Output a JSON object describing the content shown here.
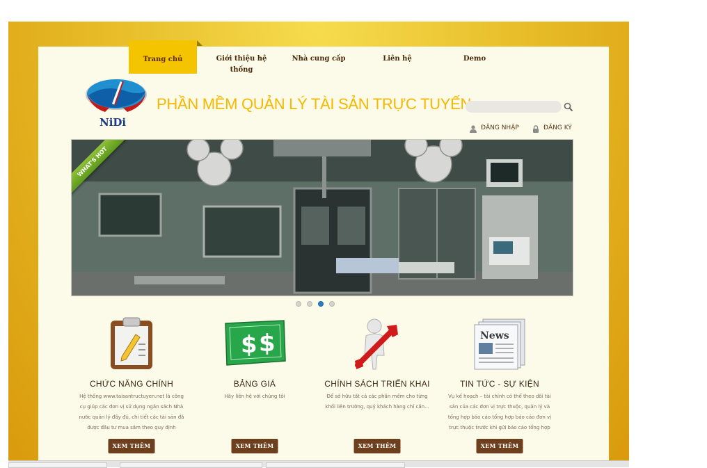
{
  "nav": {
    "items": [
      {
        "label": "Trang chủ",
        "active": true
      },
      {
        "label": "Giới thiệu hệ thống",
        "active": false
      },
      {
        "label": "Nhà cung cấp",
        "active": false
      },
      {
        "label": "Liên hệ",
        "active": false
      },
      {
        "label": "Demo",
        "active": false
      }
    ]
  },
  "header": {
    "logo_text": "NiDi",
    "site_title": "PHẦN MỀM QUẢN LÝ TÀI SẢN TRỰC TUYẾN",
    "search_placeholder": "",
    "search_icon": "magnifier-icon",
    "login_label": "ĐĂNG NHẬP",
    "register_label": "ĐĂNG KÝ"
  },
  "slider": {
    "ribbon_text": "WHAT'S HOT",
    "slide_count": 4,
    "active_slide": 3
  },
  "features": [
    {
      "icon": "clipboard-icon",
      "title": "CHỨC NĂNG CHÍNH",
      "description": "Hệ thống www.taisantructuyen.net là công cụ giúp các đơn vị sử dụng ngân sách Nhà nước quản lý đầy đủ, chi tiết các tài sản đã được đầu tư mua sắm theo quy định",
      "button": "XEM THÊM"
    },
    {
      "icon": "money-icon",
      "title": "BẢNG GIÁ",
      "description": "Hãy liên hệ với chúng tôi",
      "button": "XEM THÊM"
    },
    {
      "icon": "wrench-person-icon",
      "title": "CHÍNH SÁCH TRIỂN KHAI",
      "description": "Để sở hữu tất cả các phần mềm cho từng khối liên trường, quý khách hàng chỉ cần...",
      "button": "XEM THÊM"
    },
    {
      "icon": "news-icon",
      "title": "TIN TỨC - SỰ KIỆN",
      "description": "Vụ kế hoạch – tài chính có thể theo dõi tài sản của các đơn vị trực thuộc, quản lý và tổng hợp báo cáo tổng hợp báo cáo đơn vị trực thuộc trước khi gửi báo cáo tổng hợp",
      "button": "XEM THÊM"
    }
  ],
  "colors": {
    "frame_gold": "#e8be2a",
    "nav_active": "#f5c400",
    "button_brown": "#6e3f1c",
    "title_yellow": "#f5b800",
    "page_cream": "#fcfae8"
  }
}
